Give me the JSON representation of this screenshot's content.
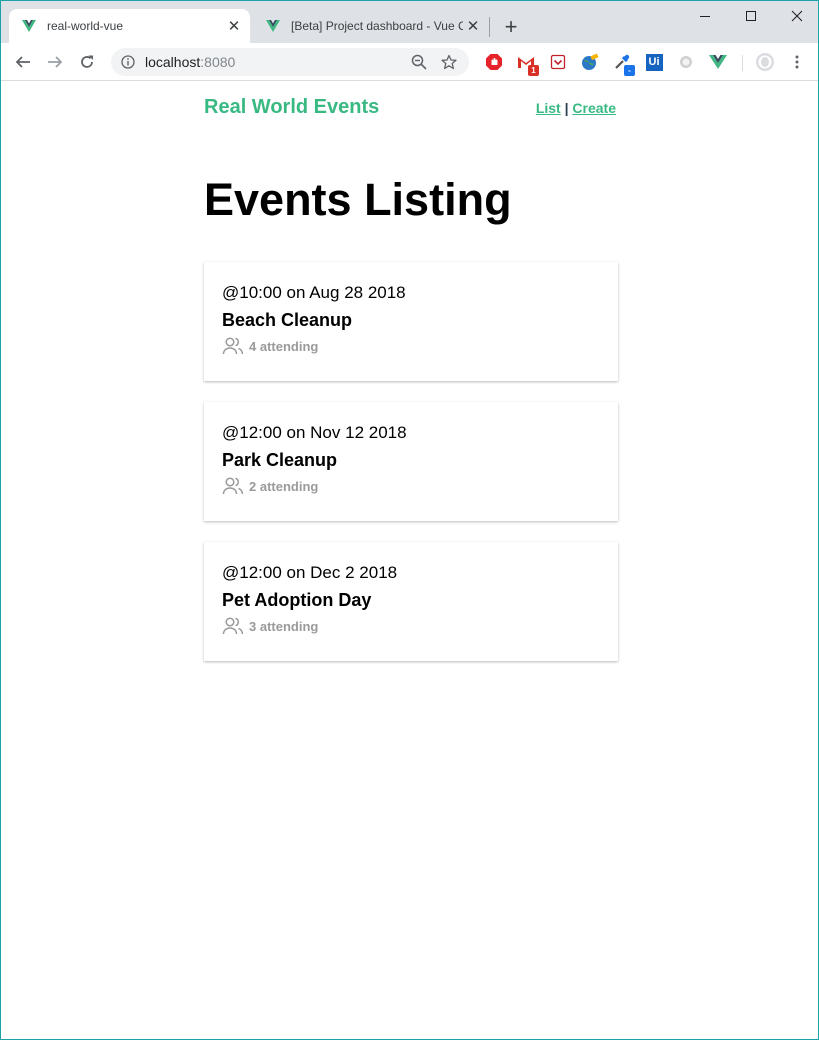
{
  "browser": {
    "tabs": [
      {
        "title": "real-world-vue",
        "active": true
      },
      {
        "title": "[Beta] Project dashboard - Vue C",
        "active": false
      }
    ],
    "address": {
      "host": "localhost",
      "port": ":8080"
    },
    "extensions": [
      {
        "name": "opera-adblock-icon"
      },
      {
        "name": "gmail-icon",
        "badge": "1"
      },
      {
        "name": "pocket-icon"
      },
      {
        "name": "earth-icon"
      },
      {
        "name": "eyedropper-icon",
        "badge": "-"
      },
      {
        "name": "ui-icon",
        "label": "Ui"
      },
      {
        "name": "record-icon"
      },
      {
        "name": "vue-devtools-icon"
      }
    ]
  },
  "site": {
    "brand": "Real World Events",
    "nav": {
      "list": "List",
      "separator": " | ",
      "create": "Create"
    },
    "heading": "Events Listing"
  },
  "events": [
    {
      "time": "@10:00 on Aug 28 2018",
      "title": "Beach Cleanup",
      "attending": "4 attending"
    },
    {
      "time": "@12:00 on Nov 12 2018",
      "title": "Park Cleanup",
      "attending": "2 attending"
    },
    {
      "time": "@12:00 on Dec 2 2018",
      "title": "Pet Adoption Day",
      "attending": "3 attending"
    }
  ],
  "colors": {
    "brand": "#39b982",
    "muted": "#9a9a9a",
    "window_border": "#1aa3a8"
  }
}
